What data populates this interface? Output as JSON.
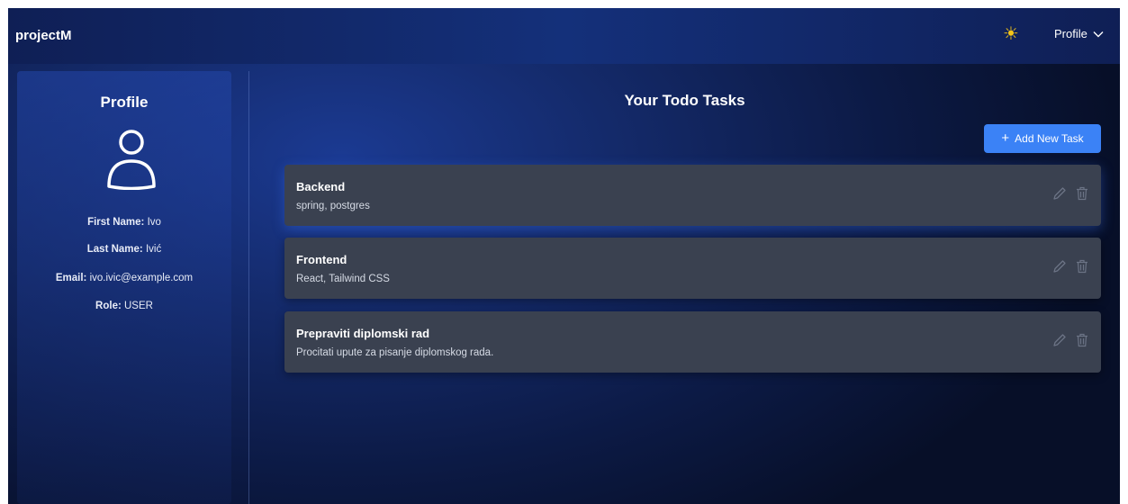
{
  "header": {
    "brand": "projectM",
    "theme_icon": "sun-icon",
    "profile_label": "Profile",
    "profile_chevron_icon": "chevron-down-icon"
  },
  "colors": {
    "accent": "#3b82f6",
    "sun": "#f5c518",
    "card": "#3a4150"
  },
  "sidebar": {
    "title": "Profile",
    "avatar_icon": "user-icon",
    "fields": [
      {
        "label": "First Name:",
        "value": "Ivo"
      },
      {
        "label": "Last Name:",
        "value": "Ivić"
      },
      {
        "label": "Email:",
        "value": "ivo.ivic@example.com"
      },
      {
        "label": "Role:",
        "value": "USER"
      }
    ]
  },
  "main": {
    "title": "Your Todo Tasks",
    "add_button_label": "Add New Task",
    "tasks": [
      {
        "title": "Backend",
        "description": "spring, postgres"
      },
      {
        "title": "Frontend",
        "description": "React, Tailwind CSS"
      },
      {
        "title": "Prepraviti diplomski rad",
        "description": "Procitati upute za pisanje diplomskog rada."
      }
    ]
  }
}
